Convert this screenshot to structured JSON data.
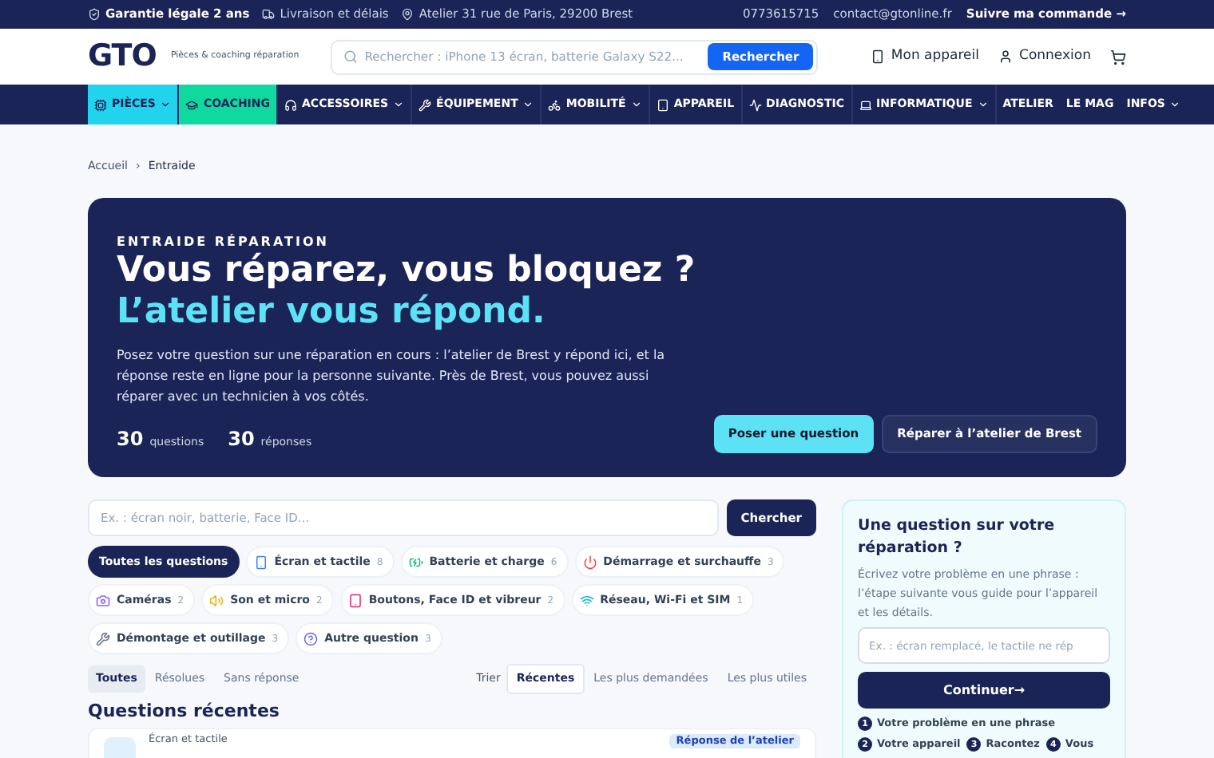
{
  "top_bar": {
    "left": [
      {
        "kind": "shield",
        "text": "Garantie légale 2 ans",
        "bold": true
      },
      {
        "kind": "truck",
        "text": "Livraison et délais",
        "bold": false
      },
      {
        "kind": "pin",
        "text": "Atelier 31 rue de Paris, 29200 Brest",
        "bold": false
      }
    ],
    "phone": "0773615715",
    "email": "contact@gtonline.fr",
    "track": "Suivre ma commande →"
  },
  "header": {
    "logo": "GTO",
    "tagline": "Pièces & coaching réparation",
    "search": {
      "placeholder": "Rechercher : iPhone 13 écran, batterie Galaxy S22...",
      "button": "Rechercher"
    },
    "links": [
      {
        "kind": "phone",
        "label": "Mon appareil"
      },
      {
        "kind": "user",
        "label": "Connexion"
      }
    ]
  },
  "nav": {
    "items": [
      {
        "kind": "parts",
        "label": "PIÈCES",
        "caret": true,
        "color": "#22d3ee"
      },
      {
        "kind": "coaching",
        "label": "COACHING",
        "caret": false,
        "color": "#10d9a0"
      },
      {
        "kind": "headphones",
        "label": "ACCESSOIRES",
        "caret": true
      },
      {
        "kind": "tools",
        "label": "ÉQUIPEMENT",
        "caret": true
      },
      {
        "kind": "bike",
        "label": "MOBILITÉ",
        "caret": true
      },
      {
        "kind": "device",
        "label": "APPAREIL",
        "caret": false
      },
      {
        "kind": "pulse",
        "label": "DIAGNOSTIC",
        "caret": false
      },
      {
        "kind": "laptop",
        "label": "INFORMATIQUE",
        "caret": true
      }
    ],
    "right": [
      {
        "label": "ATELIER",
        "caret": false
      },
      {
        "label": "LE MAG",
        "caret": false
      },
      {
        "label": "INFOS",
        "caret": true
      }
    ]
  },
  "breadcrumb": [
    "Accueil",
    "Entraide"
  ],
  "breadcrumb_separator": "›",
  "hero": {
    "eyebrow": "ENTRAIDE RÉPARATION",
    "title": "Vous réparez, vous bloquez ?",
    "subtitle": "L’atelier vous répond.",
    "description": "Posez votre question sur une réparation en cours : l’atelier de Brest y répond ici, et la réponse reste en ligne pour la personne suivante. Près de Brest, vous pouvez aussi réparer avec un technicien à vos côtés.",
    "stats": [
      {
        "value": "30",
        "label": "questions"
      },
      {
        "value": "30",
        "label": "réponses"
      }
    ],
    "buttons": [
      {
        "kind": "primary",
        "label": "Poser une question"
      },
      {
        "kind": "secondary",
        "label": "Réparer à l’atelier de Brest"
      }
    ]
  },
  "search": {
    "placeholder": "Ex. : écran noir, batterie, Face ID...",
    "button": "Chercher"
  },
  "categories": [
    {
      "kind": "all",
      "label": "Toutes les questions",
      "selected": true
    },
    {
      "kind": "screen",
      "label": "Écran et tactile",
      "count": "8",
      "selected": false,
      "color": "#3b82f6"
    },
    {
      "kind": "battery",
      "label": "Batterie et charge",
      "count": "6",
      "selected": false,
      "color": "#10b981"
    },
    {
      "kind": "power",
      "label": "Démarrage et surchauffe",
      "count": "3",
      "selected": false,
      "color": "#ef4444"
    },
    {
      "kind": "camera",
      "label": "Caméras",
      "count": "2",
      "selected": false,
      "color": "#8b5cf6"
    },
    {
      "kind": "sound",
      "label": "Son et micro",
      "count": "2",
      "selected": false,
      "color": "#eab308"
    },
    {
      "kind": "buttons",
      "label": "Boutons, Face ID et vibreur",
      "count": "2",
      "selected": false,
      "color": "#db2777"
    },
    {
      "kind": "wifi",
      "label": "Réseau, Wi-Fi et SIM",
      "count": "1",
      "selected": false,
      "color": "#06b6d4"
    },
    {
      "kind": "tools",
      "label": "Démontage et outillage",
      "count": "3",
      "selected": false,
      "color": "#64748b"
    },
    {
      "kind": "help",
      "label": "Autre question",
      "count": "3",
      "selected": false,
      "color": "#6366f1"
    }
  ],
  "status_tabs": [
    {
      "label": "Toutes",
      "selected": true
    },
    {
      "label": "Résolues",
      "selected": false
    },
    {
      "label": "Sans réponse",
      "selected": false
    }
  ],
  "sort": {
    "label": "Trier",
    "options": [
      {
        "label": "Récentes",
        "selected": true
      },
      {
        "label": "Les plus demandées",
        "selected": false
      },
      {
        "label": "Les plus utiles",
        "selected": false
      }
    ]
  },
  "section_title": "Questions récentes",
  "question_card": {
    "category": "Écran et tactile",
    "badge": "Réponse de l’atelier"
  },
  "ask_panel": {
    "title": "Une question sur votre réparation ?",
    "description": "Écrivez votre problème en une phrase : l’étape suivante vous guide pour l’appareil et les détails.",
    "placeholder": "Ex. : écran remplacé, le tactile ne rép",
    "button": "Continuer→",
    "steps": [
      {
        "number": "1",
        "label": "Votre problème en une phrase"
      },
      {
        "number": "2",
        "label": "Votre appareil"
      },
      {
        "number": "3",
        "label": "Racontez"
      },
      {
        "number": "4",
        "label": "Vous"
      }
    ]
  }
}
